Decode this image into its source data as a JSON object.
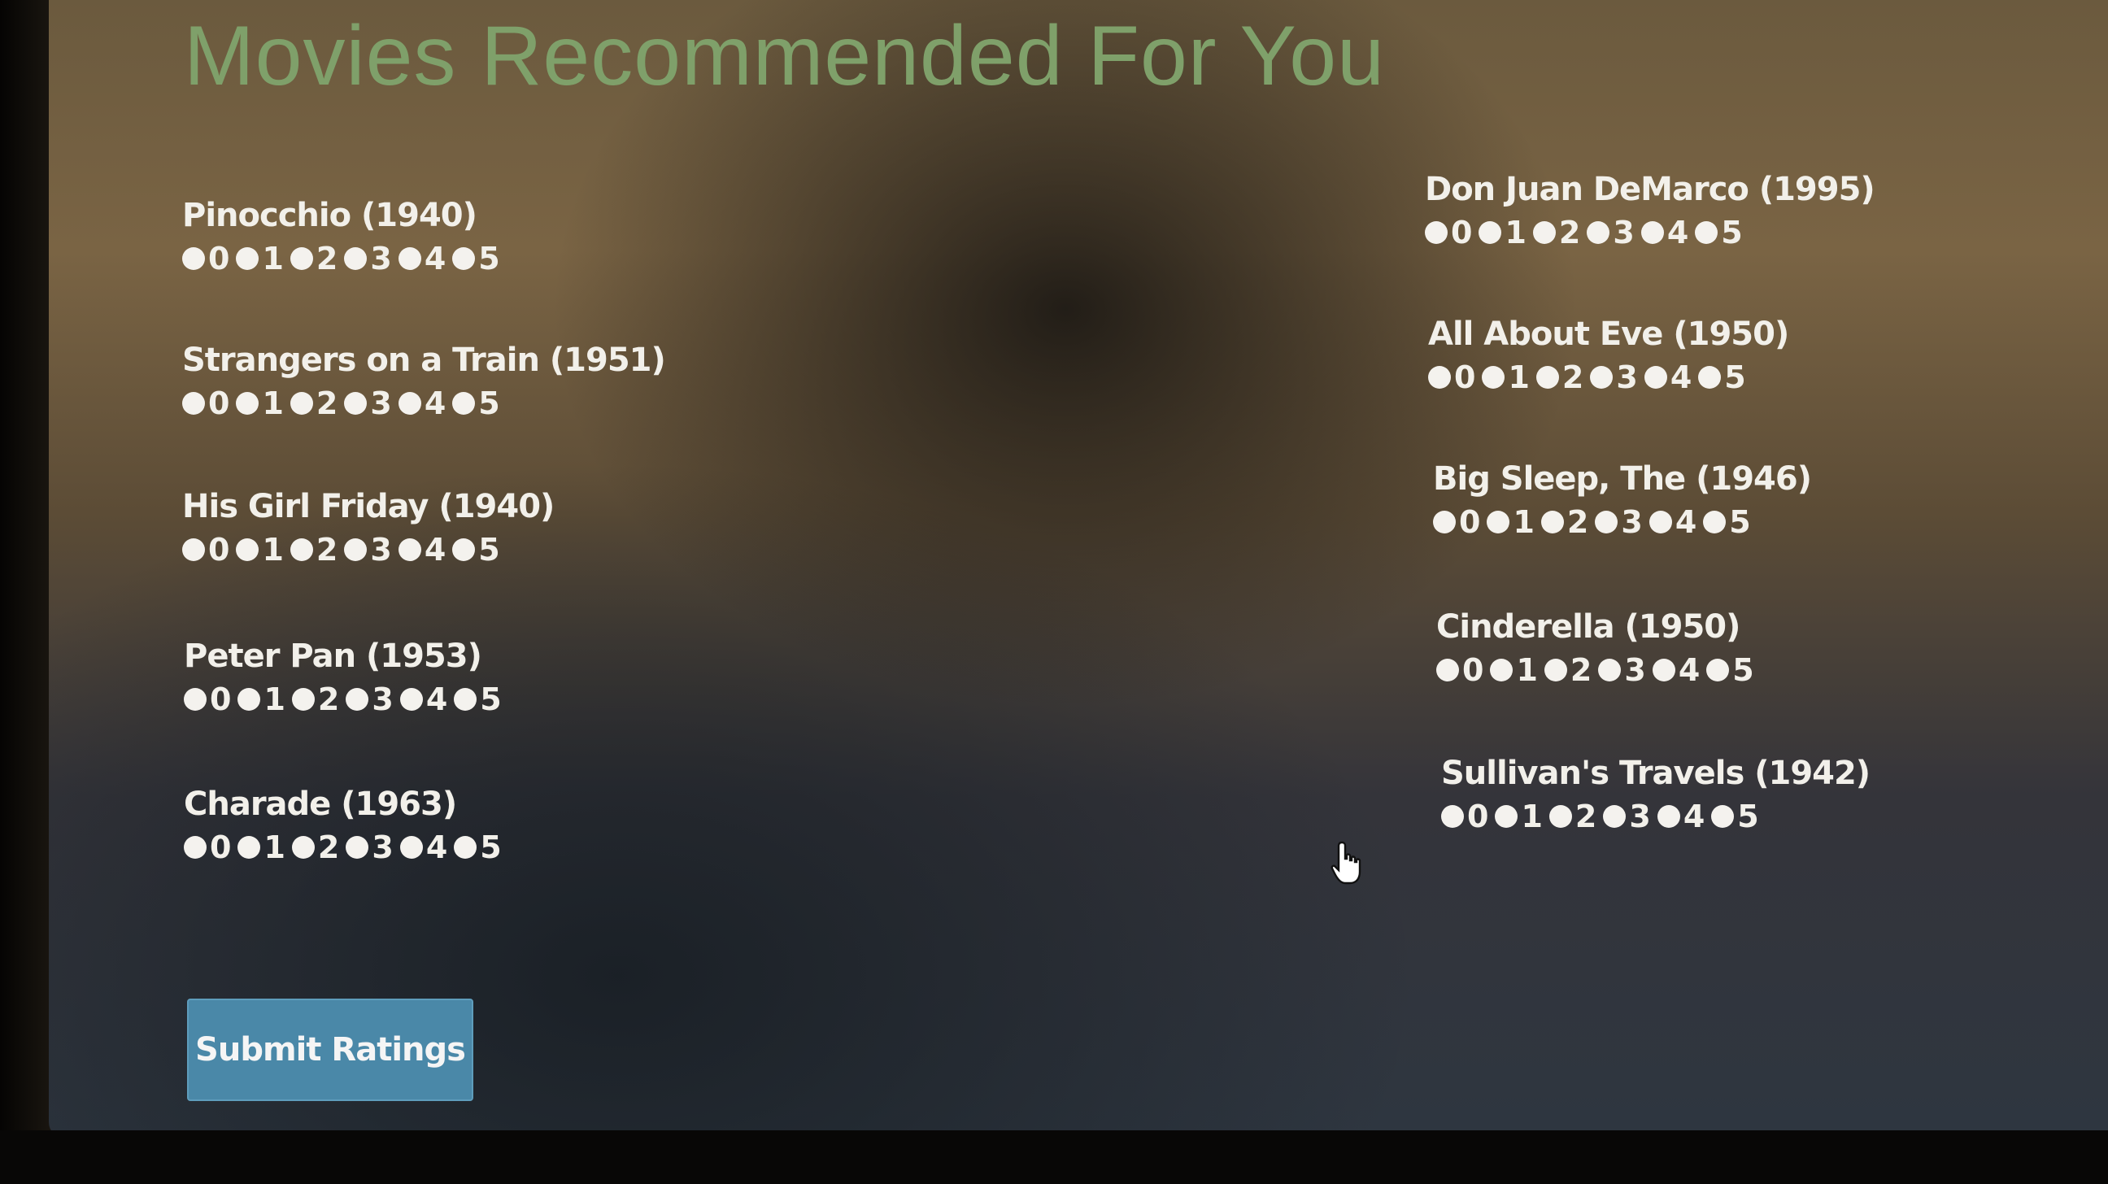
{
  "page": {
    "title": "Movies Recommended For You"
  },
  "rating_options": [
    "0",
    "1",
    "2",
    "3",
    "4",
    "5"
  ],
  "movies_left": [
    {
      "title": "Pinocchio (1940)"
    },
    {
      "title": "Strangers on a Train (1951)"
    },
    {
      "title": "His Girl Friday (1940)"
    },
    {
      "title": "Peter Pan (1953)"
    },
    {
      "title": "Charade (1963)"
    }
  ],
  "movies_right": [
    {
      "title": "Don Juan DeMarco (1995)"
    },
    {
      "title": "All About Eve (1950)"
    },
    {
      "title": "Big Sleep, The (1946)"
    },
    {
      "title": "Cinderella (1950)"
    },
    {
      "title": "Sullivan's Travels (1942)"
    }
  ],
  "submit": {
    "label": "Submit Ratings"
  },
  "colors": {
    "title": "#7fa06a",
    "button": "#4a88a8",
    "text": "#f2f0ea"
  },
  "icons": {
    "cursor": "hand-pointer-icon"
  }
}
